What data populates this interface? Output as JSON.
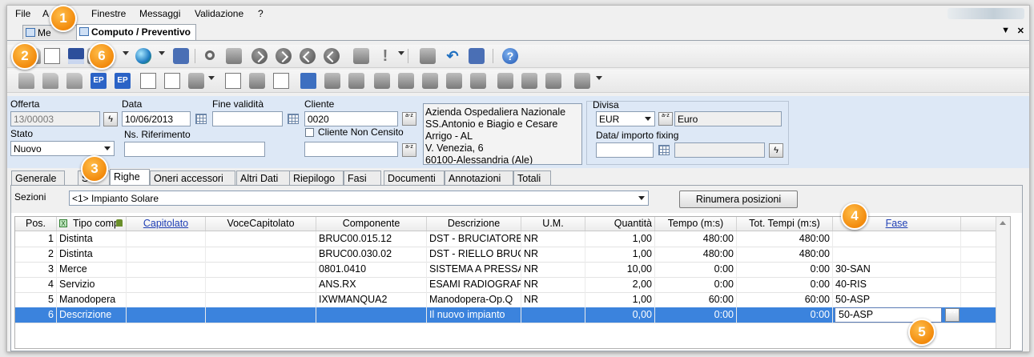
{
  "menu": [
    "File",
    "A",
    "Finestre",
    "Messaggi",
    "Validazione",
    "?"
  ],
  "doc_tabs": [
    {
      "label": "Me",
      "active": false
    },
    {
      "label": "Computo / Preventivo",
      "active": true
    }
  ],
  "window_controls": {
    "dropdown": "▼",
    "close": "✕"
  },
  "form": {
    "offerta_label": "Offerta",
    "offerta_value": "13/00003",
    "data_label": "Data",
    "data_value": "10/06/2013",
    "fine_validita_label": "Fine validità",
    "fine_validita_value": "",
    "cliente_label": "Cliente",
    "cliente_value": "0020",
    "stato_label": "Stato",
    "stato_value": "Nuovo",
    "ns_riferimento_label": "Ns. Riferimento",
    "ns_riferimento_value": "",
    "cliente_non_censito_label": "Cliente Non Censito",
    "address": "Azienda Ospedaliera Nazionale\nSS.Antonio e Biagio e Cesare\nArrigo - AL\nV. Venezia, 6\n60100-Alessandria (Ale)",
    "divisa_label": "Divisa",
    "divisa_code": "EUR",
    "divisa_name": "Euro",
    "fixing_label": "Data/ importo fixing",
    "picker_glyph": "a-z"
  },
  "tabs": [
    "Generale",
    "Se",
    "Righe",
    "Oneri accessori",
    "Altri Dati",
    "Riepilogo",
    "Fasi",
    "Documenti",
    "Annotazioni",
    "Totali"
  ],
  "active_tab": "Righe",
  "sezioni_label": "Sezioni",
  "sezioni_value": "<1> Impianto Solare",
  "rinumera_label": "Rinumera posizioni",
  "grid": {
    "headers": [
      "Pos.",
      "Tipo comp",
      "Capitolato",
      "VoceCapitolato",
      "Componente",
      "Descrizione",
      "U.M.",
      "Quantità",
      "Tempo (m:s)",
      "Tot. Tempi (m:s)",
      "Fase"
    ],
    "rows": [
      [
        "1",
        "Distinta",
        "",
        "",
        "BRUC00.015.12",
        "DST - BRUCIATORE",
        "NR",
        "1,00",
        "480:00",
        "480:00",
        ""
      ],
      [
        "2",
        "Distinta",
        "",
        "",
        "BRUC00.030.02",
        "DST - RIELLO BRUC",
        "NR",
        "1,00",
        "480:00",
        "480:00",
        ""
      ],
      [
        "3",
        "Merce",
        "",
        "",
        "0801.0410",
        "SISTEMA A PRESSA",
        "NR",
        "10,00",
        "0:00",
        "0:00",
        "30-SAN"
      ],
      [
        "4",
        "Servizio",
        "",
        "",
        "ANS.RX",
        "ESAMI RADIOGRAF",
        "NR",
        "2,00",
        "0:00",
        "0:00",
        "40-RIS"
      ],
      [
        "5",
        "Manodopera",
        "",
        "",
        "IXWMANQUA2",
        "Manodopera-Op.Q",
        "NR",
        "1,00",
        "60:00",
        "60:00",
        "50-ASP"
      ],
      [
        "6",
        "Descrizione",
        "",
        "",
        "",
        "Il nuovo impianto",
        "",
        "0,00",
        "0:00",
        "0:00",
        "50-ASP"
      ]
    ],
    "selected_row": 5
  },
  "badges": [
    "1",
    "2",
    "3",
    "4",
    "5",
    "6"
  ]
}
